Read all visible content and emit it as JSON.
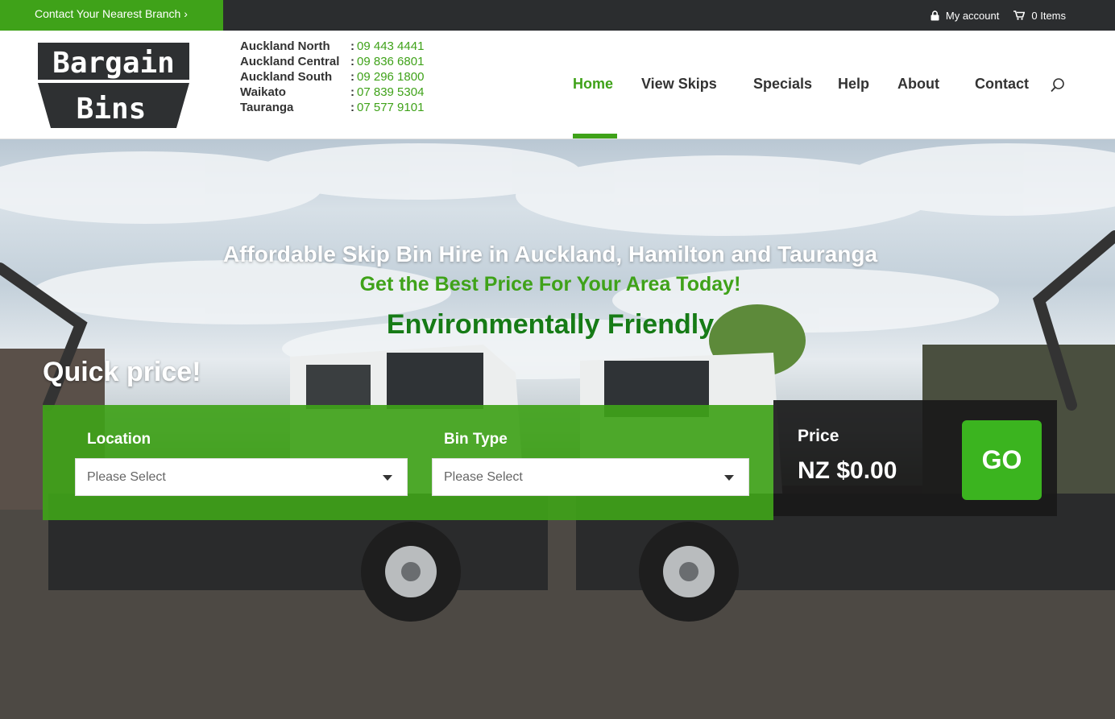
{
  "topbar": {
    "branch_link": "Contact Your Nearest Branch ›",
    "account_label": "My account",
    "cart_label": "0 Items"
  },
  "logo": {
    "line1": "Bargain",
    "line2": "Bins"
  },
  "branches": [
    {
      "name": "Auckland North",
      "phone": "09 443 4441"
    },
    {
      "name": "Auckland Central",
      "phone": "09 836 6801"
    },
    {
      "name": "Auckland South",
      "phone": "09 296 1800"
    },
    {
      "name": "Waikato",
      "phone": "07 839 5304"
    },
    {
      "name": "Tauranga",
      "phone": "07 577 9101"
    }
  ],
  "nav": {
    "items": [
      "Home",
      "View Skips",
      "Specials",
      "Help",
      "About",
      "Contact"
    ],
    "active": "Home"
  },
  "hero": {
    "headline": "Affordable Skip Bin Hire in Auckland, Hamilton and Tauranga",
    "subheadline": "Get the Best Price For Your Area Today!",
    "tagline": "Environmentally Friendly",
    "quick_price": "Quick price!"
  },
  "form": {
    "location_label": "Location",
    "location_value": "Please Select",
    "bin_type_label": "Bin Type",
    "bin_type_value": "Please Select",
    "price_label": "Price",
    "price_value": "NZ $0.00",
    "go_label": "GO"
  },
  "colors": {
    "brand_green": "#3fa219",
    "dark_green": "#167b16",
    "topbar_bg": "#2b2d2f"
  }
}
